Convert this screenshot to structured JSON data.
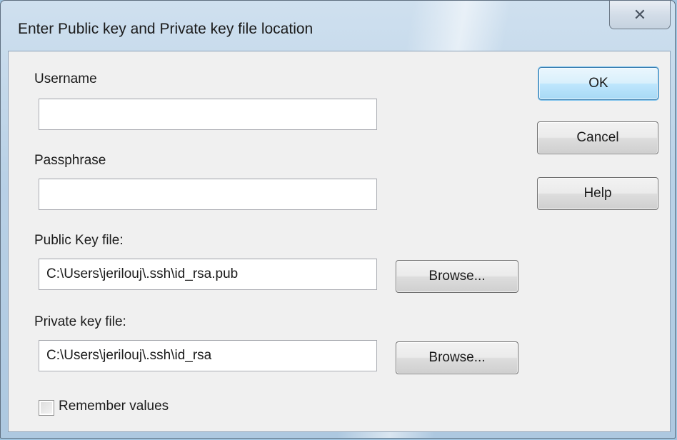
{
  "dialog": {
    "title": "Enter Public key and Private key file location",
    "close_icon": "close-icon"
  },
  "fields": {
    "username": {
      "label": "Username",
      "value": ""
    },
    "passphrase": {
      "label": "Passphrase",
      "value": ""
    },
    "public_key": {
      "label": "Public Key file:",
      "value": "C:\\Users\\jerilouj\\.ssh\\id_rsa.pub"
    },
    "private_key": {
      "label": "Private key file:",
      "value": "C:\\Users\\jerilouj\\.ssh\\id_rsa"
    }
  },
  "buttons": {
    "ok": "OK",
    "cancel": "Cancel",
    "help": "Help",
    "browse_public": "Browse...",
    "browse_private": "Browse..."
  },
  "remember": {
    "label": "Remember values",
    "checked": false
  }
}
